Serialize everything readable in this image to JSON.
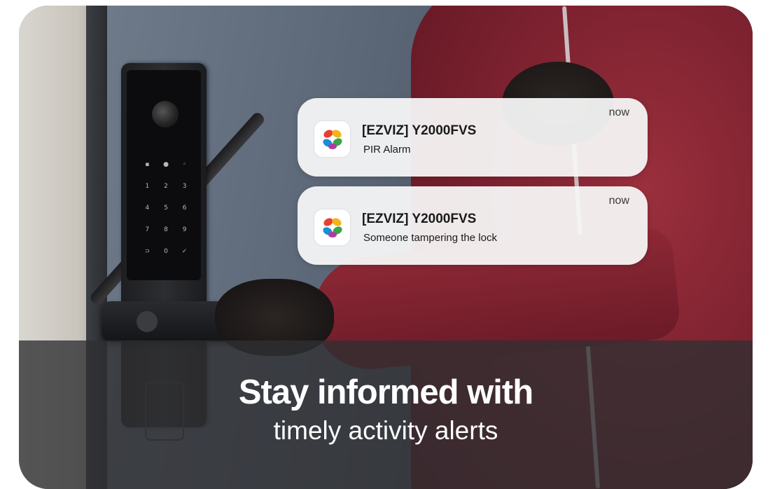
{
  "notifications": [
    {
      "app_icon": "ezviz-app-icon",
      "title": "[EZVIZ] Y2000FVS",
      "body": "PIR Alarm",
      "time": "now"
    },
    {
      "app_icon": "ezviz-app-icon",
      "title": "[EZVIZ] Y2000FVS",
      "body": "Someone tampering the lock",
      "time": "now"
    }
  ],
  "caption": {
    "line1": "Stay informed with",
    "line2": "timely activity alerts"
  },
  "colors": {
    "hoodie": "#7e2230",
    "notification_bg": "#f6f6f6",
    "caption_band": "#303032",
    "icon_petals": [
      "#e8402e",
      "#f2b418",
      "#3aa54a",
      "#1b8ed8",
      "#b33aa0"
    ]
  }
}
